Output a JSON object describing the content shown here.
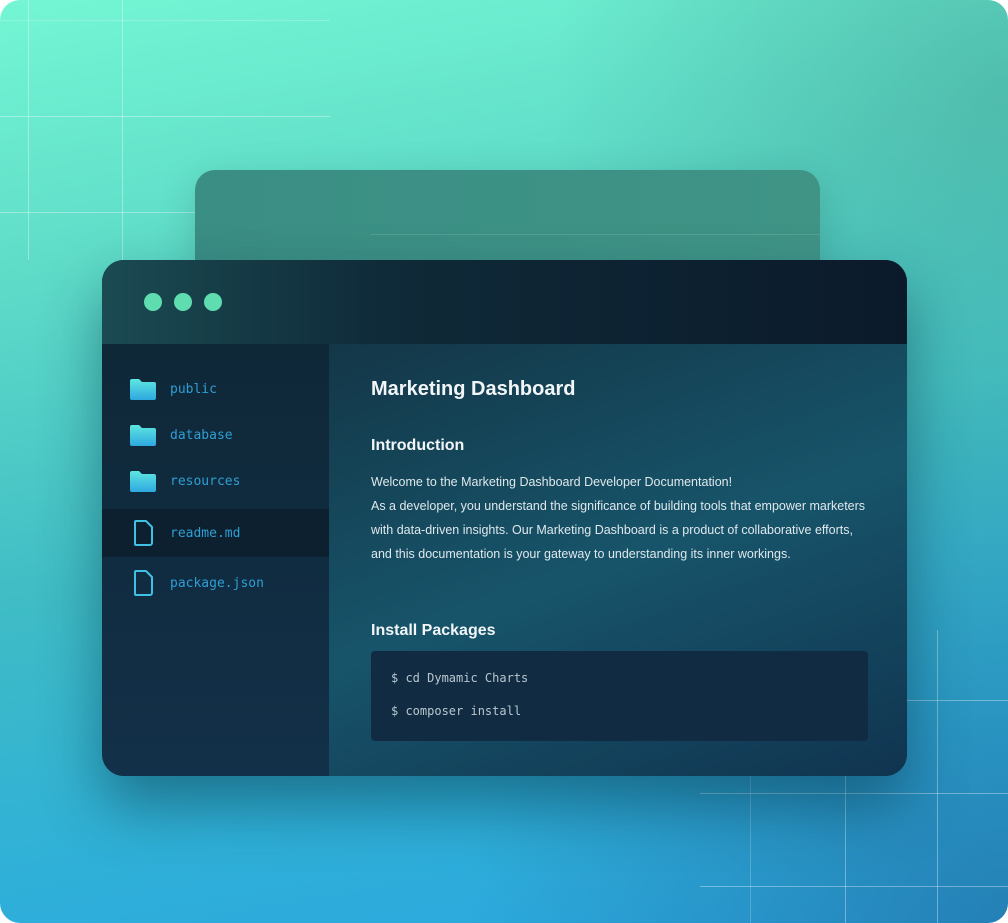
{
  "colors": {
    "accent_dot": "#5fdcb0",
    "file_label": "#2e9ed3",
    "folder_icon": "#3fc6e8"
  },
  "window": {
    "controls": [
      "dot",
      "dot",
      "dot"
    ]
  },
  "sidebar": {
    "items": [
      {
        "label": "public",
        "icon": "folder-icon",
        "active": false
      },
      {
        "label": "database",
        "icon": "folder-icon",
        "active": false
      },
      {
        "label": "resources",
        "icon": "folder-icon",
        "active": false
      },
      {
        "label": "readme.md",
        "icon": "file-icon",
        "active": true
      },
      {
        "label": "package.json",
        "icon": "file-icon",
        "active": false
      }
    ]
  },
  "main": {
    "title": "Marketing Dashboard",
    "intro_heading": "Introduction",
    "intro_line1": "Welcome to the Marketing Dashboard Developer Documentation!",
    "intro_body": "As a developer, you understand the significance of building tools that empower marketers with data-driven insights. Our Marketing Dashboard is a product of collaborative efforts, and this documentation is your gateway to understanding its inner workings.",
    "install_heading": "Install Packages",
    "code_lines": [
      "$ cd Dymamic Charts",
      "$ composer install"
    ]
  }
}
